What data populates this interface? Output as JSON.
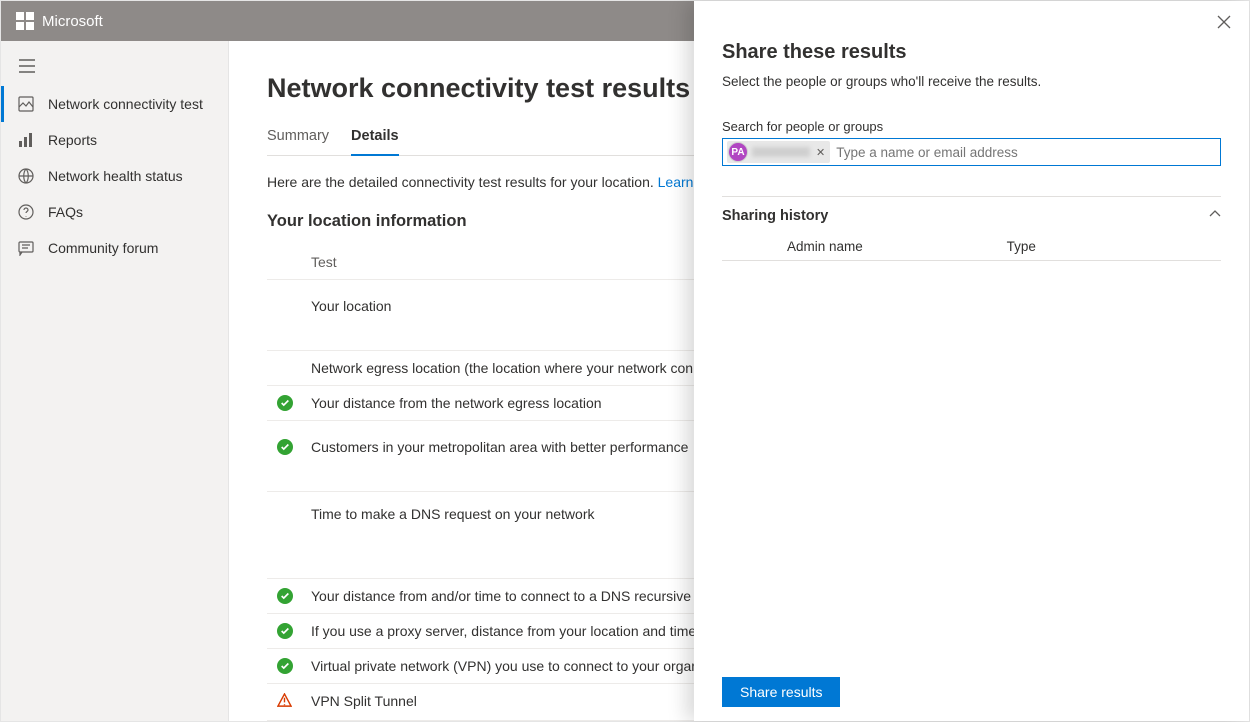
{
  "topbar": {
    "brand": "Microsoft"
  },
  "sidebar": {
    "items": [
      {
        "label": "Network connectivity test"
      },
      {
        "label": "Reports"
      },
      {
        "label": "Network health status"
      },
      {
        "label": "FAQs"
      },
      {
        "label": "Community forum"
      }
    ]
  },
  "main": {
    "title": "Network connectivity test results for you",
    "tabs": {
      "summary": "Summary",
      "details": "Details"
    },
    "intro_a": "Here are the detailed connectivity test results for your location. ",
    "intro_link": "Learn about the tests v",
    "section": "Your location information",
    "test_header": "Test",
    "tests": [
      {
        "label": "Your location",
        "status": ""
      },
      {
        "label": "Network egress location (the location where your network connects to you",
        "status": ""
      },
      {
        "label": "Your distance from the network egress location",
        "status": "pass"
      },
      {
        "label": "Customers in your metropolitan area with better performance",
        "status": "pass"
      },
      {
        "label": "Time to make a DNS request on your network",
        "status": ""
      },
      {
        "label": "Your distance from and/or time to connect to a DNS recursive resolver",
        "status": "pass"
      },
      {
        "label": "If you use a proxy server, distance from your location and time to connect",
        "status": "pass"
      },
      {
        "label": "Virtual private network (VPN) you use to connect to your organization",
        "status": "pass"
      },
      {
        "label": "VPN Split Tunnel",
        "status": "warn"
      }
    ]
  },
  "panel": {
    "title": "Share these results",
    "subtitle": "Select the people or groups who'll receive the results.",
    "field_label": "Search for people or groups",
    "chip_initials": "PA",
    "input_placeholder": "Type a name or email address",
    "history_title": "Sharing history",
    "hist_col1": "Admin name",
    "hist_col2": "Type",
    "share_btn": "Share results"
  }
}
